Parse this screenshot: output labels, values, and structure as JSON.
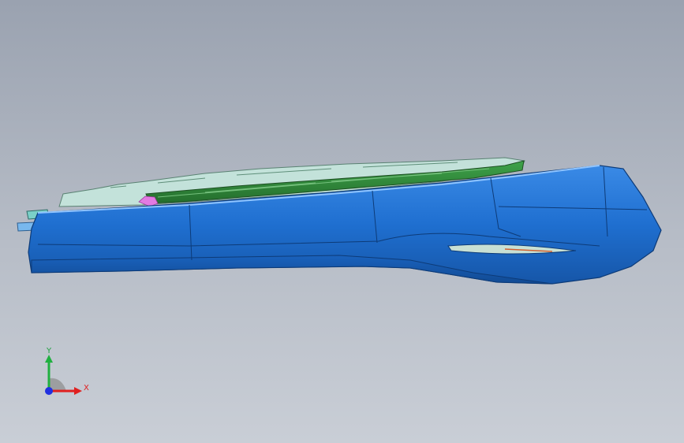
{
  "viewport": {
    "background_top": "#9aa2b0",
    "background_bottom": "#c9ced6"
  },
  "model": {
    "body_color": "#1f6fd0",
    "body_dark": "#1656a8",
    "body_light": "#3a8ae6",
    "pcb_color": "#2f8a3a",
    "translucent_color": "#bfe8dc",
    "accent_color": "#e070e0",
    "slot_color": "#c8e0d4"
  },
  "triad": {
    "x_label": "X",
    "y_label": "Y",
    "x_color": "#e02020",
    "y_color": "#20b040",
    "z_color": "#2030e0"
  }
}
